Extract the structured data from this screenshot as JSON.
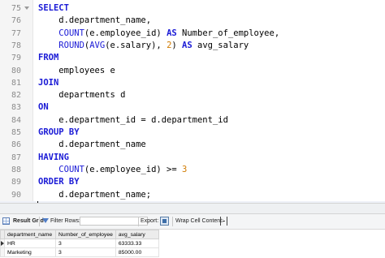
{
  "editor": {
    "lines": [
      {
        "num": "75",
        "parts": [
          {
            "t": "SELECT",
            "c": "kw"
          }
        ]
      },
      {
        "num": "76",
        "parts": [
          {
            "t": "    d.department_name,",
            "c": ""
          }
        ]
      },
      {
        "num": "77",
        "parts": [
          {
            "t": "    ",
            "c": ""
          },
          {
            "t": "COUNT",
            "c": "fn"
          },
          {
            "t": "(e.employee_id) ",
            "c": ""
          },
          {
            "t": "AS",
            "c": "kw"
          },
          {
            "t": " Number_of_employee,",
            "c": ""
          }
        ]
      },
      {
        "num": "78",
        "parts": [
          {
            "t": "    ",
            "c": ""
          },
          {
            "t": "ROUND",
            "c": "fn"
          },
          {
            "t": "(",
            "c": ""
          },
          {
            "t": "AVG",
            "c": "fn"
          },
          {
            "t": "(e.salary), ",
            "c": ""
          },
          {
            "t": "2",
            "c": "num"
          },
          {
            "t": ") ",
            "c": ""
          },
          {
            "t": "AS",
            "c": "kw"
          },
          {
            "t": " avg_salary",
            "c": ""
          }
        ]
      },
      {
        "num": "79",
        "parts": [
          {
            "t": "FROM",
            "c": "kw"
          }
        ]
      },
      {
        "num": "80",
        "parts": [
          {
            "t": "    employees e",
            "c": ""
          }
        ]
      },
      {
        "num": "81",
        "parts": [
          {
            "t": "JOIN",
            "c": "kw"
          }
        ]
      },
      {
        "num": "82",
        "parts": [
          {
            "t": "    departments d",
            "c": ""
          }
        ]
      },
      {
        "num": "83",
        "parts": [
          {
            "t": "ON",
            "c": "kw"
          }
        ]
      },
      {
        "num": "84",
        "parts": [
          {
            "t": "    e.department_id = d.department_id",
            "c": ""
          }
        ]
      },
      {
        "num": "85",
        "parts": [
          {
            "t": "GROUP BY",
            "c": "kw"
          }
        ]
      },
      {
        "num": "86",
        "parts": [
          {
            "t": "    d.department_name",
            "c": ""
          }
        ]
      },
      {
        "num": "87",
        "parts": [
          {
            "t": "HAVING",
            "c": "kw"
          }
        ]
      },
      {
        "num": "88",
        "parts": [
          {
            "t": "    ",
            "c": ""
          },
          {
            "t": "COUNT",
            "c": "fn"
          },
          {
            "t": "(e.employee_id) >= ",
            "c": ""
          },
          {
            "t": "3",
            "c": "num"
          }
        ]
      },
      {
        "num": "89",
        "parts": [
          {
            "t": "ORDER BY",
            "c": "kw"
          }
        ]
      },
      {
        "num": "90",
        "parts": [
          {
            "t": "    d.department_name;",
            "c": ""
          }
        ]
      },
      {
        "num": "91",
        "parts": [
          {
            "t": "",
            "c": ""
          }
        ]
      }
    ],
    "current_line": "91"
  },
  "toolbar": {
    "result_grid_label": "Result Grid",
    "filter_rows_label": "Filter Rows:",
    "filter_value": "",
    "export_label": "Export:",
    "wrap_label": "Wrap Cell Content:"
  },
  "results": {
    "columns": [
      "department_name",
      "Number_of_employee",
      "avg_salary"
    ],
    "rows": [
      [
        "HR",
        "3",
        "63333.33"
      ],
      [
        "Marketing",
        "3",
        "85000.00"
      ]
    ]
  },
  "colors": {
    "keyword": "#1a1ad6",
    "number": "#d07a00",
    "current_line_bg": "#eef1f8"
  },
  "icons": {
    "result_grid": "grid-icon",
    "filter": "filter-icon",
    "export": "export-icon",
    "wrap": "wrap-cell-icon",
    "fold": "fold-arrow-icon"
  }
}
